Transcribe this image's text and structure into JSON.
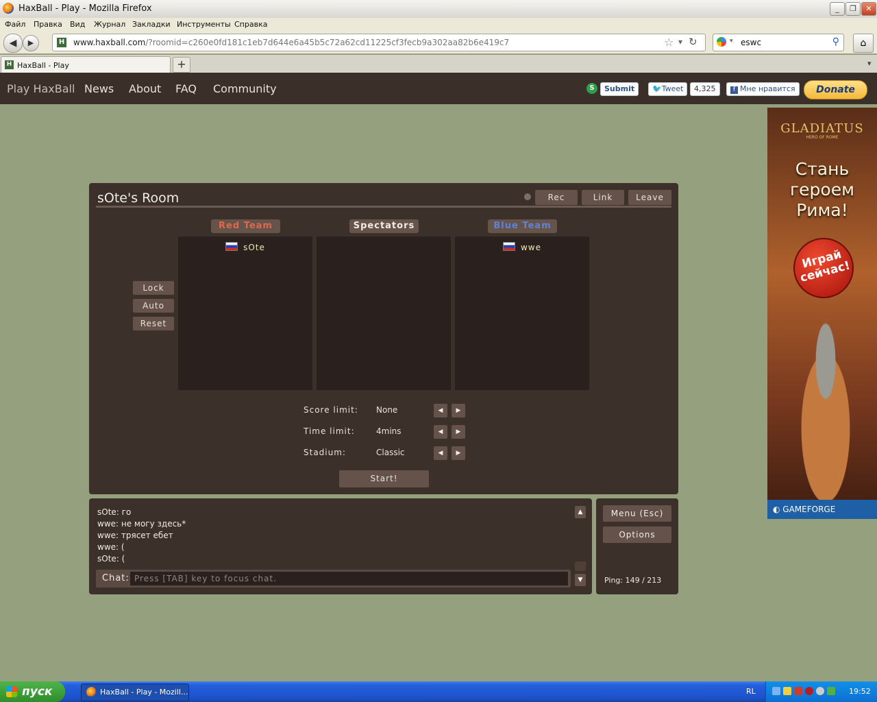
{
  "window": {
    "title": "HaxBall - Play - Mozilla Firefox",
    "min": "_",
    "max": "❐",
    "close": "✕"
  },
  "menubar": [
    "Файл",
    "Правка",
    "Вид",
    "Журнал",
    "Закладки",
    "Инструменты",
    "Справка"
  ],
  "navbar": {
    "back": "◀",
    "forward": "▶",
    "url_host": "www.haxball.com",
    "url_path": "/?roomid=c260e0fd181c1eb7d644e6a45b5c72a62cd11225cf3fecb9a302aa82b6e419c7",
    "star": "☆",
    "dropdown": "▾",
    "reload": "↻",
    "search_value": "eswc",
    "search_icon": "⚲",
    "home": "⌂",
    "site_icon": "H"
  },
  "tabs": {
    "active_label": "HaxBall - Play",
    "new_tab": "+",
    "list_all": "▾"
  },
  "site": {
    "nav": [
      "Play HaxBall",
      "News",
      "About",
      "FAQ",
      "Community"
    ],
    "stumble_submit": "Submit",
    "tweet": "Tweet",
    "tweet_count": "4,325",
    "fb_like": "Мне нравится",
    "donate": "Donate"
  },
  "ad": {
    "logo": "GLADIATUS",
    "logo_sub": "HERO OF ROME",
    "headline_1": "Стань",
    "headline_2": "героем",
    "headline_3": "Рима!",
    "cta_1": "Играй",
    "cta_2": "сейчас!",
    "brand": "GAMEFORGE"
  },
  "room": {
    "title": "sOte's Room",
    "rec": "Rec",
    "link": "Link",
    "leave": "Leave",
    "red_team_label": "Red Team",
    "spectators_label": "Spectators",
    "blue_team_label": "Blue Team",
    "red_players": [
      "sOte"
    ],
    "spectators": [],
    "blue_players": [
      "wwe"
    ],
    "lock": "Lock",
    "auto": "Auto",
    "reset": "Reset",
    "settings": [
      {
        "label": "Score limit:",
        "value": "None"
      },
      {
        "label": "Time limit:",
        "value": "4mins"
      },
      {
        "label": "Stadium:",
        "value": "Classic"
      }
    ],
    "arrow_left": "◀",
    "arrow_right": "▶",
    "start": "Start!",
    "colors": {
      "red": "#e0674c",
      "blue": "#5f83d8",
      "panel": "#3c302a"
    }
  },
  "chat": {
    "lines": [
      "sOte: го",
      "wwe: не могу здесь*",
      "wwe: трясет ебет",
      "wwe: (",
      "sOte: ("
    ],
    "label": "Chat:",
    "placeholder": "Press [TAB] key to focus chat.",
    "scroll_up": "▲",
    "scroll_down": "▼"
  },
  "menu": {
    "menu_btn": "Menu (Esc)",
    "options_btn": "Options",
    "ping": "Ping: 149 / 213"
  },
  "taskbar": {
    "start": "пуск",
    "task_item": "HaxBall - Play - Mozill...",
    "lang": "RL",
    "clock": "19:52"
  }
}
